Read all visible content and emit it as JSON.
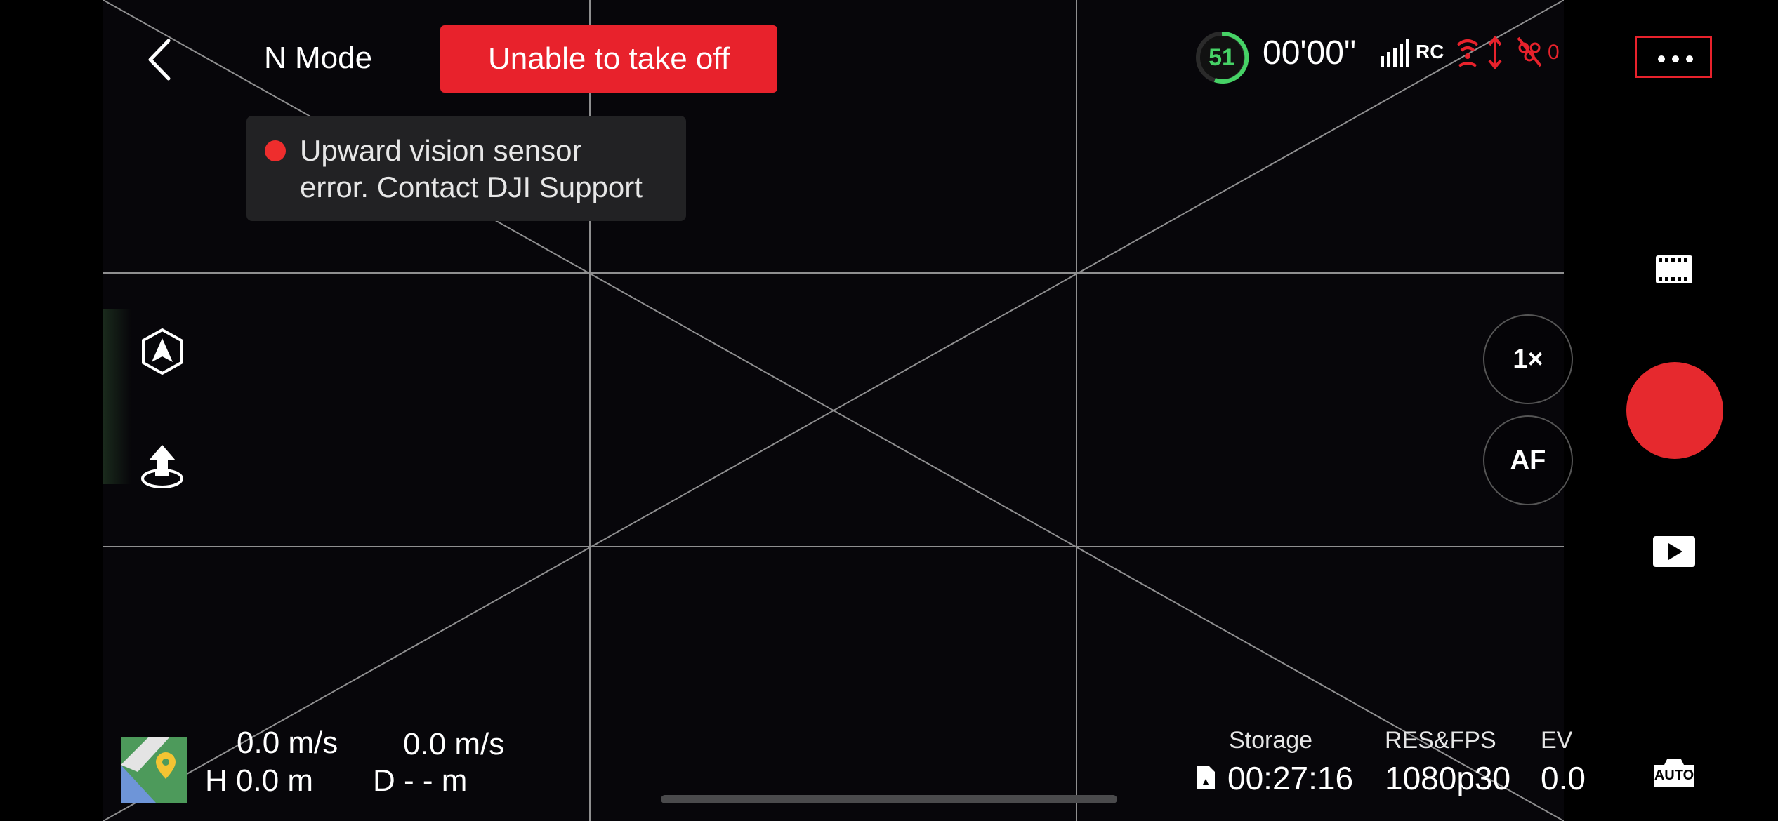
{
  "header": {
    "back_icon": "chevron-left-icon",
    "mode": "N Mode",
    "takeoff_warning": "Unable to take off",
    "warning_color": "#e8222c"
  },
  "alert": {
    "line1": "Upward vision sensor",
    "line2": "error. Contact DJI Support"
  },
  "status": {
    "battery": "51",
    "flight_time": "00'00\"",
    "signal_label": "RC",
    "obstacle_count": "0",
    "icons": [
      "battery-ring-icon",
      "signal-bars-icon",
      "wifi-warning-icon",
      "altitude-warning-icon",
      "obstacle-off-icon"
    ]
  },
  "more_menu": {
    "icon": "more-dots-icon"
  },
  "left_controls": {
    "icons": [
      "flight-mode-icon",
      "takeoff-icon"
    ]
  },
  "camera": {
    "zoom": "1×",
    "focus": "AF",
    "icons": [
      "film-mode-icon",
      "record-button",
      "playback-icon",
      "auto-camera-icon"
    ]
  },
  "telemetry": {
    "horizontal_speed": "0.0 m/s",
    "vertical_speed": "0.0 m/s",
    "height": "H 0.0 m",
    "distance": "D - - m"
  },
  "camera_info": {
    "storage_label": "Storage",
    "storage_value": "00:27:16",
    "res_label": "RES&FPS",
    "res_value": "1080p30",
    "ev_label": "EV",
    "ev_value": "0.0",
    "auto_label": "AUTO"
  }
}
